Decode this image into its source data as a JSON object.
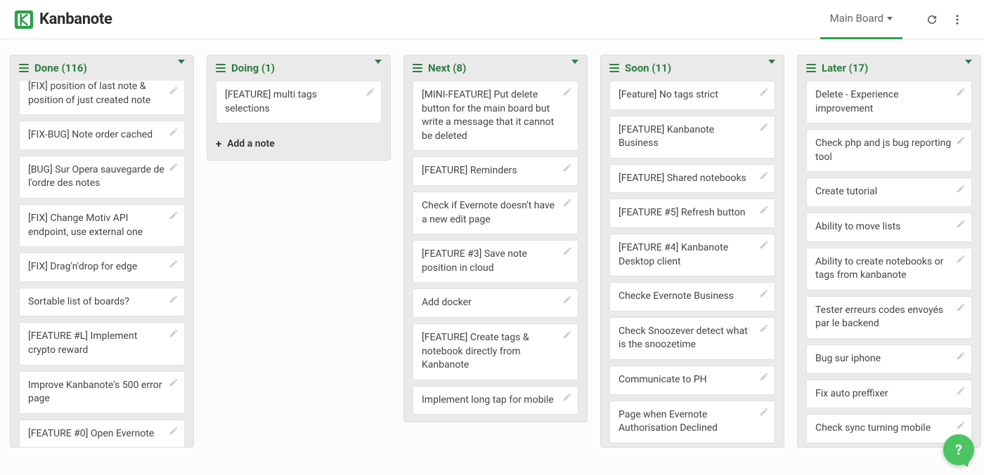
{
  "header": {
    "app_name": "Kanbanote",
    "board_selector": "Main Board"
  },
  "add_note_label": "Add a note",
  "columns": [
    {
      "title": "Done (116)",
      "truncated_top": true,
      "show_add": false,
      "cards": [
        "[FIX] position of last note & position of just created note",
        "[FIX-BUG] Note order cached",
        "[BUG] Sur Opera sauvegarde de l'ordre des notes",
        "[FIX] Change Motiv API endpoint, use external one",
        "[FIX] Drag'n'drop for edge",
        "Sortable list of boards?",
        "[FEATURE #L] Implement crypto reward",
        "Improve Kanbanote's 500 error page",
        "[FEATURE #0] Open Evernote"
      ]
    },
    {
      "title": "Doing (1)",
      "truncated_top": false,
      "show_add": true,
      "cards": [
        "[FEATURE] multi tags selections"
      ]
    },
    {
      "title": "Next (8)",
      "truncated_top": false,
      "show_add": false,
      "cards": [
        "[MINI-FEATURE] Put delete button for the main board but write a message that it cannot be deleted",
        "[FEATURE] Reminders",
        "Check if Evernote doesn't have a new edit page",
        "[FEATURE #3] Save note position in cloud",
        "Add docker",
        "[FEATURE] Create tags & notebook directly from Kanbanote",
        "Implement long tap for mobile"
      ]
    },
    {
      "title": "Soon (11)",
      "truncated_top": false,
      "show_add": false,
      "cards": [
        "[Feature] No tags strict",
        "[FEATURE] Kanbanote Business",
        "[FEATURE] Shared notebooks",
        "[FEATURE #5] Refresh button",
        "[FEATURE #4] Kanbanote Desktop client",
        "Checke Evernote Business",
        "Check Snoozever detect what is the snoozetime",
        "Communicate to PH",
        "Page when Evernote Authorisation Declined"
      ]
    },
    {
      "title": "Later (17)",
      "truncated_top": false,
      "show_add": false,
      "cards": [
        "Delete - Experience improvement",
        "Check php and js bug reporting tool",
        "Create tutorial",
        "Ability to move lists",
        "Ability to create notebooks or tags from kanbanote",
        "Tester erreurs codes envoyés par le backend",
        "Bug sur iphone",
        "Fix auto preffixer",
        "Check sync turning mobile"
      ]
    }
  ]
}
